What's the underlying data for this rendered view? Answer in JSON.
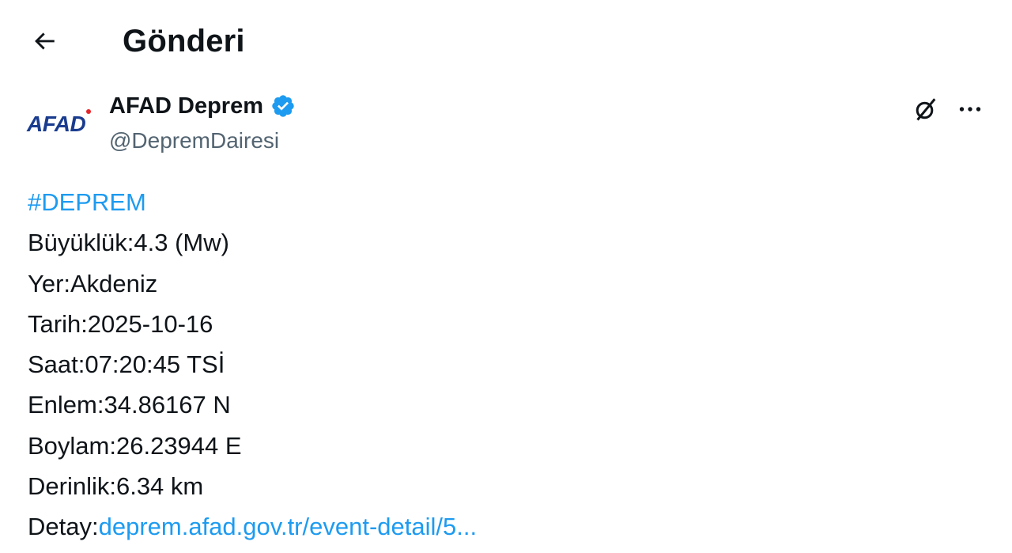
{
  "header": {
    "title": "Gönderi"
  },
  "author": {
    "logo_text": "AFAD",
    "display_name": "AFAD Deprem",
    "handle": "@DepremDairesi",
    "verified": true
  },
  "colors": {
    "link": "#1d9bf0",
    "text": "#0f1419",
    "secondary": "#536471",
    "logo_blue": "#1a3c8f",
    "logo_red": "#e3262b"
  },
  "icons": {
    "back": "arrow-left-icon",
    "verified": "verified-badge-icon",
    "grok": "grok-icon",
    "more": "more-horizontal-icon"
  },
  "tweet": {
    "hashtag": "#DEPREM",
    "lines": [
      "Büyüklük:4.3 (Mw)",
      "Yer:Akdeniz",
      "Tarih:2025-10-16",
      "Saat:07:20:45 TSİ",
      "Enlem:34.86167 N",
      "Boylam:26.23944 E",
      "Derinlik:6.34 km"
    ],
    "detail_label": "Detay:",
    "detail_link": "deprem.afad.gov.tr/event-detail/5..."
  }
}
